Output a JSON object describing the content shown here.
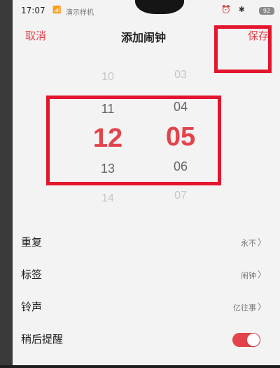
{
  "status": {
    "time": "17:07",
    "carrier": "演示样机",
    "battery": "92",
    "icons": {
      "wifi": "wifi-icon",
      "alarm": "alarm-icon",
      "bluetooth": "bluetooth-icon"
    }
  },
  "header": {
    "cancel": "取消",
    "title": "添加闹钟",
    "save": "保存"
  },
  "picker": {
    "hours": [
      "10",
      "11",
      "12",
      "13",
      "14"
    ],
    "minutes": [
      "03",
      "04",
      "05",
      "06",
      "07"
    ],
    "selected_hour": "12",
    "selected_minute": "05"
  },
  "settings": {
    "repeat": {
      "label": "重复",
      "value": "永不"
    },
    "tag": {
      "label": "标签",
      "value": "闹钟"
    },
    "ringtone": {
      "label": "铃声",
      "value": "亿往事"
    },
    "snooze": {
      "label": "稍后提醒",
      "enabled": true
    }
  },
  "chevron": "〉",
  "colors": {
    "accent": "#e3434b",
    "highlight": "#e3162d"
  }
}
